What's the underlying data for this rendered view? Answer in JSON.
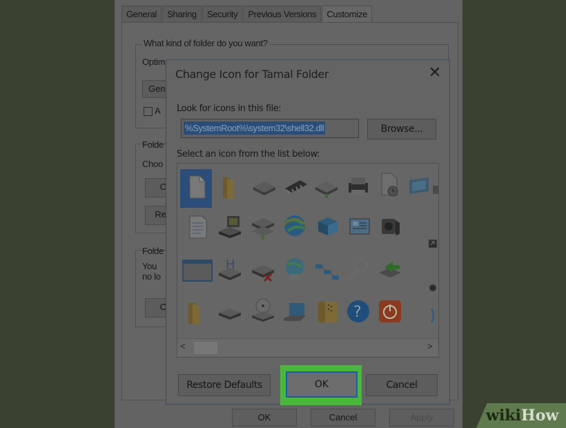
{
  "background_tabs": [
    "General",
    "Sharing",
    "Security",
    "Previous Versions",
    "Customize"
  ],
  "background_panel": {
    "question": "What kind of folder do you want?",
    "optimize_label_fragment": "Optim",
    "dropdown_fragment": "Gen",
    "checkbox_fragment": "A",
    "folder_pictures_fragment": "Folde",
    "choose_fragment": "Choo",
    "choose_btn_fragment": "C",
    "restore_btn_fragment": "Re",
    "folder_icons_fragment": "Folde",
    "you_fragment": "You",
    "nolo_fragment": "no lo",
    "change_btn_fragment": "C"
  },
  "background_buttons": {
    "ok": "OK",
    "cancel": "Cancel",
    "apply": "Apply"
  },
  "dialog": {
    "title": "Change Icon for Tamal Folder",
    "close_glyph": "✕",
    "look_for_label": "Look for icons in this file:",
    "path_value": "%SystemRoot%\\system32\\shell32.dll",
    "browse_label": "Browse...",
    "select_label": "Select an icon from the list below:",
    "scroll_left": "<",
    "scroll_right": ">",
    "restore_defaults_label": "Restore Defaults",
    "ok_label": "OK",
    "cancel_label": "Cancel"
  },
  "icons": [
    "blank-document-icon",
    "folder-icon",
    "drive-icon",
    "memory-chip-icon",
    "network-drive-icon",
    "printer-icon",
    "document-clock-icon",
    "monitor-icon",
    "shortcut-arrow-icon",
    "text-document-icon",
    "desktop-computer-icon",
    "network-drives-icon",
    "globe-icon",
    "network-folder-icon",
    "screen-settings-icon",
    "speaker-icon",
    "shortcut-arrow-icon",
    "window-icon",
    "hard-drive-icon",
    "disconnected-drive-icon",
    "network-globe-icon",
    "network-connections-icon",
    "search-magnifier-icon",
    "recycle-arrow-icon",
    "small-icon",
    "folder-icon",
    "disk-drive-icon",
    "cd-drive-icon",
    "laptop-icon",
    "archive-folder-icon",
    "help-question-icon",
    "power-icon",
    "partial-icon"
  ],
  "watermark": {
    "wiki": "wiki",
    "how": "How"
  },
  "colors": {
    "highlight_green": "#49b83a",
    "ok_border_blue": "#1c5ea1",
    "path_selection": "#2b4d79"
  }
}
